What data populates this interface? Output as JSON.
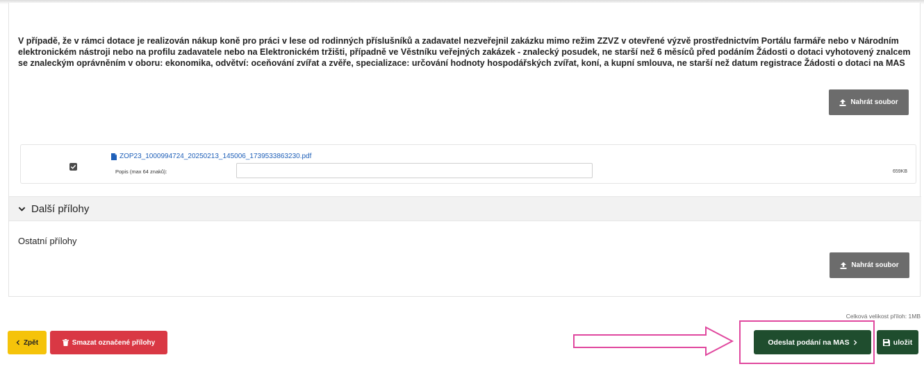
{
  "attachment": {
    "description": "V případě, že v rámci dotace je realizován nákup koně pro práci v lese od rodinných příslušníků a zadavatel nezveřejnil zakázku mimo režim ZZVZ v otevřené výzvě prostřednictvím Portálu farmáře nebo v Národním elektronickém nástroji nebo na profilu zadavatele nebo na Elektronickém tržišti, případně ve Věstníku veřejných zakázek - znalecký posudek, ne starší než 6 měsíců před podáním Žádosti o dotaci vyhotovený znalcem se znaleckým oprávněním v oboru: ekonomika, odvětví: oceňování zvířat a zvěře, specializace: určování hodnoty hospodářských zvířat, koní, a kupní smlouva, ne starší než datum registrace Žádosti o dotaci na MAS",
    "upload_label": "Nahrát soubor",
    "file": {
      "name": "ZOP23_1000994724_20250213_145006_1739533863230.pdf",
      "popis_label": "Popis (max 64 znaků):",
      "popis_value": "",
      "size": "659KB",
      "checked": true
    }
  },
  "other_section": {
    "title": "Další přílohy",
    "subtitle": "Ostatní přílohy",
    "upload_label": "Nahrát soubor"
  },
  "total_size": "Celková velikost příloh: 1MB",
  "footer": {
    "back_label": "Zpět",
    "delete_label": "Smazat označené přílohy",
    "send_label": "Odeslat podání na MAS",
    "save_label": "uložit"
  },
  "colors": {
    "upload_button": "#6c6c6c",
    "back_button": "#f5c30a",
    "delete_button": "#d93844",
    "primary_button": "#1f4d2e",
    "annotation": "#e0479e",
    "file_link": "#1e5fb8"
  },
  "icons": {
    "upload": "upload-icon",
    "file": "pdf-file-icon",
    "collapse": "chevron-down-icon",
    "back": "chevron-left-icon",
    "delete": "trash-icon",
    "send": "chevron-right-icon",
    "save": "floppy-disk-icon"
  }
}
